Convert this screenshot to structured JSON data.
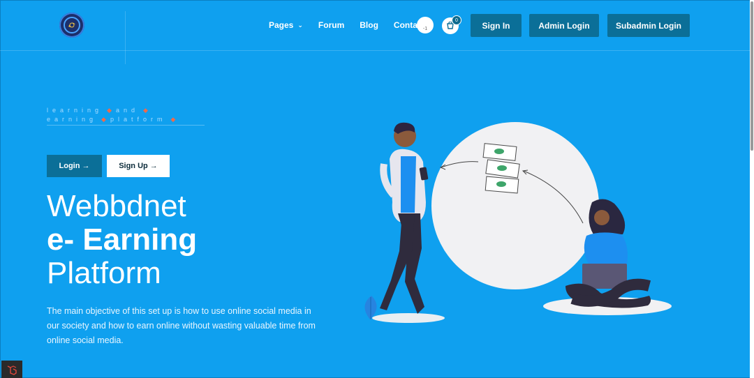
{
  "header": {
    "nav": {
      "pages": "Pages",
      "forum": "Forum",
      "blog": "Blog",
      "contact": "Contact"
    },
    "avatar_alt": "-1",
    "cart_count": "0",
    "buttons": {
      "sign_in": "Sign In",
      "admin_login": "Admin Login",
      "subadmin_login": "Subadmin Login"
    }
  },
  "hero": {
    "tagline_words": [
      "learning",
      "and",
      "earning",
      "platform"
    ],
    "login_label": "Login →",
    "signup_label": "Sign Up →",
    "title_line1": "Webbdnet",
    "title_line2": "e- Earning",
    "title_line3": "Platform",
    "description": "The main objective of this set up is how to use online social media in our society and how to earn online without wasting valuable time from online social media."
  },
  "colors": {
    "background": "#0fa0ef",
    "button": "#0b6f98",
    "accent_dot": "#f06a4b"
  },
  "icons": [
    "logo-icon",
    "chevron-down-icon",
    "cart-icon",
    "laravel-icon"
  ]
}
